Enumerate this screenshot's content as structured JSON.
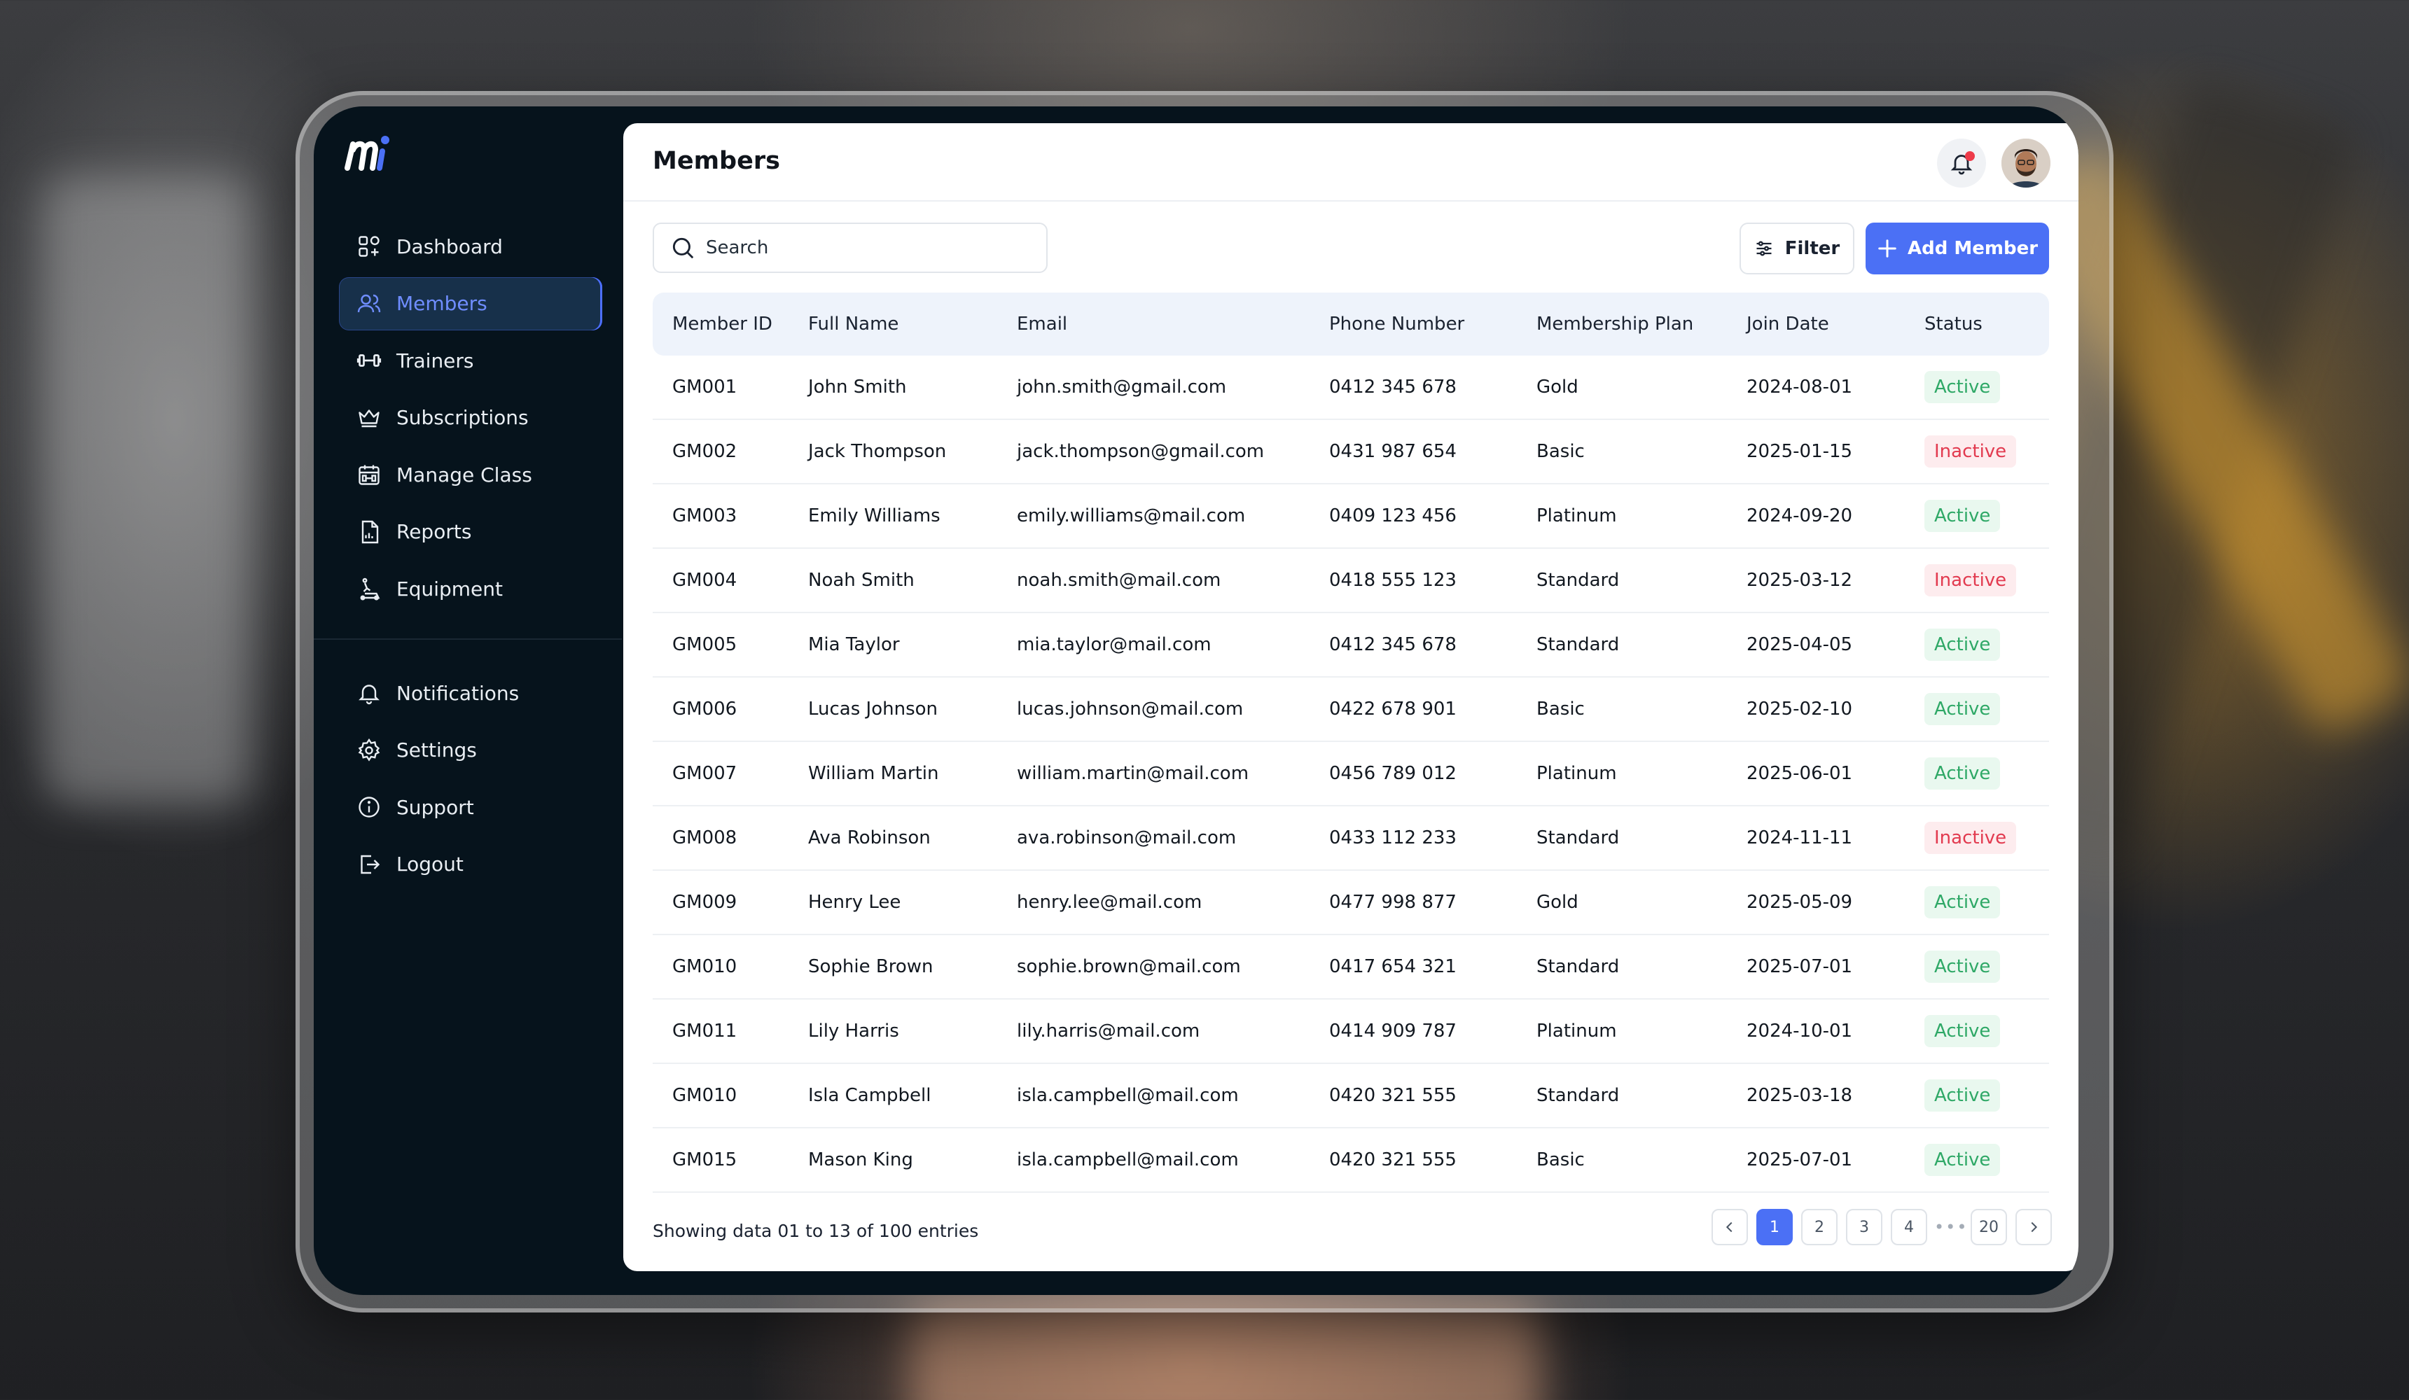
{
  "sidebar": {
    "logo_alt": "m",
    "main_items": [
      {
        "label": "Dashboard",
        "icon": "dashboard-icon",
        "active": false
      },
      {
        "label": "Members",
        "icon": "users-icon",
        "active": true
      },
      {
        "label": "Trainers",
        "icon": "dumbbell-icon",
        "active": false
      },
      {
        "label": "Subscriptions",
        "icon": "crown-icon",
        "active": false
      },
      {
        "label": "Manage Class",
        "icon": "calendar-icon",
        "active": false
      },
      {
        "label": "Reports",
        "icon": "report-icon",
        "active": false
      },
      {
        "label": "Equipment",
        "icon": "treadmill-icon",
        "active": false
      }
    ],
    "bottom_items": [
      {
        "label": "Notifications",
        "icon": "bell-icon"
      },
      {
        "label": "Settings",
        "icon": "gear-icon"
      },
      {
        "label": "Support",
        "icon": "info-icon"
      },
      {
        "label": "Logout",
        "icon": "logout-icon"
      }
    ]
  },
  "header": {
    "title": "Members",
    "notification_icon": "bell-icon",
    "avatar": "user-avatar"
  },
  "toolbar": {
    "search_placeholder": "Search",
    "filter_label": "Filter",
    "add_label": "Add Member"
  },
  "table": {
    "columns": [
      "Member ID",
      "Full Name",
      "Email",
      "Phone Number",
      "Membership Plan",
      "Join Date",
      "Status"
    ],
    "rows": [
      [
        "GM001",
        "John Smith",
        "john.smith@gmail.com",
        "0412 345 678",
        "Gold",
        "2024-08-01",
        "Active"
      ],
      [
        "GM002",
        "Jack Thompson",
        "jack.thompson@gmail.com",
        "0431 987 654",
        "Basic",
        "2025-01-15",
        "Inactive"
      ],
      [
        "GM003",
        "Emily Williams",
        "emily.williams@mail.com",
        "0409 123 456",
        "Platinum",
        "2024-09-20",
        "Active"
      ],
      [
        "GM004",
        "Noah Smith",
        "noah.smith@mail.com",
        "0418 555 123",
        "Standard",
        "2025-03-12",
        "Inactive"
      ],
      [
        "GM005",
        "Mia Taylor",
        "mia.taylor@mail.com",
        "0412 345 678",
        "Standard",
        "2025-04-05",
        "Active"
      ],
      [
        "GM006",
        "Lucas Johnson",
        "lucas.johnson@mail.com",
        "0422 678 901",
        "Basic",
        "2025-02-10",
        "Active"
      ],
      [
        "GM007",
        "William Martin",
        "william.martin@mail.com",
        "0456 789 012",
        "Platinum",
        "2025-06-01",
        "Active"
      ],
      [
        "GM008",
        "Ava Robinson",
        "ava.robinson@mail.com",
        "0433 112 233",
        "Standard",
        "2024-11-11",
        "Inactive"
      ],
      [
        "GM009",
        "Henry Lee",
        "henry.lee@mail.com",
        "0477 998 877",
        "Gold",
        "2025-05-09",
        "Active"
      ],
      [
        "GM010",
        "Sophie Brown",
        "sophie.brown@mail.com",
        "0417 654 321",
        "Standard",
        "2025-07-01",
        "Active"
      ],
      [
        "GM011",
        "Lily Harris",
        "lily.harris@mail.com",
        "0414 909 787",
        "Platinum",
        "2024-10-01",
        "Active"
      ],
      [
        "GM010",
        "Isla Campbell",
        "isla.campbell@mail.com",
        "0420 321 555",
        "Standard",
        "2025-03-18",
        "Active"
      ],
      [
        "GM015",
        "Mason King",
        "isla.campbell@mail.com",
        "0420 321 555",
        "Basic",
        "2025-07-01",
        "Active"
      ]
    ]
  },
  "footer": {
    "summary": "Showing data 01 to 13 of  100 entries",
    "pages": [
      "1",
      "2",
      "3",
      "4"
    ],
    "last_page": "20",
    "current_page": "1"
  },
  "colors": {
    "accent": "#4b70f5",
    "sidebar_bg": "#06131c",
    "active_green": "#2ea866",
    "inactive_red": "#e23a4f"
  }
}
